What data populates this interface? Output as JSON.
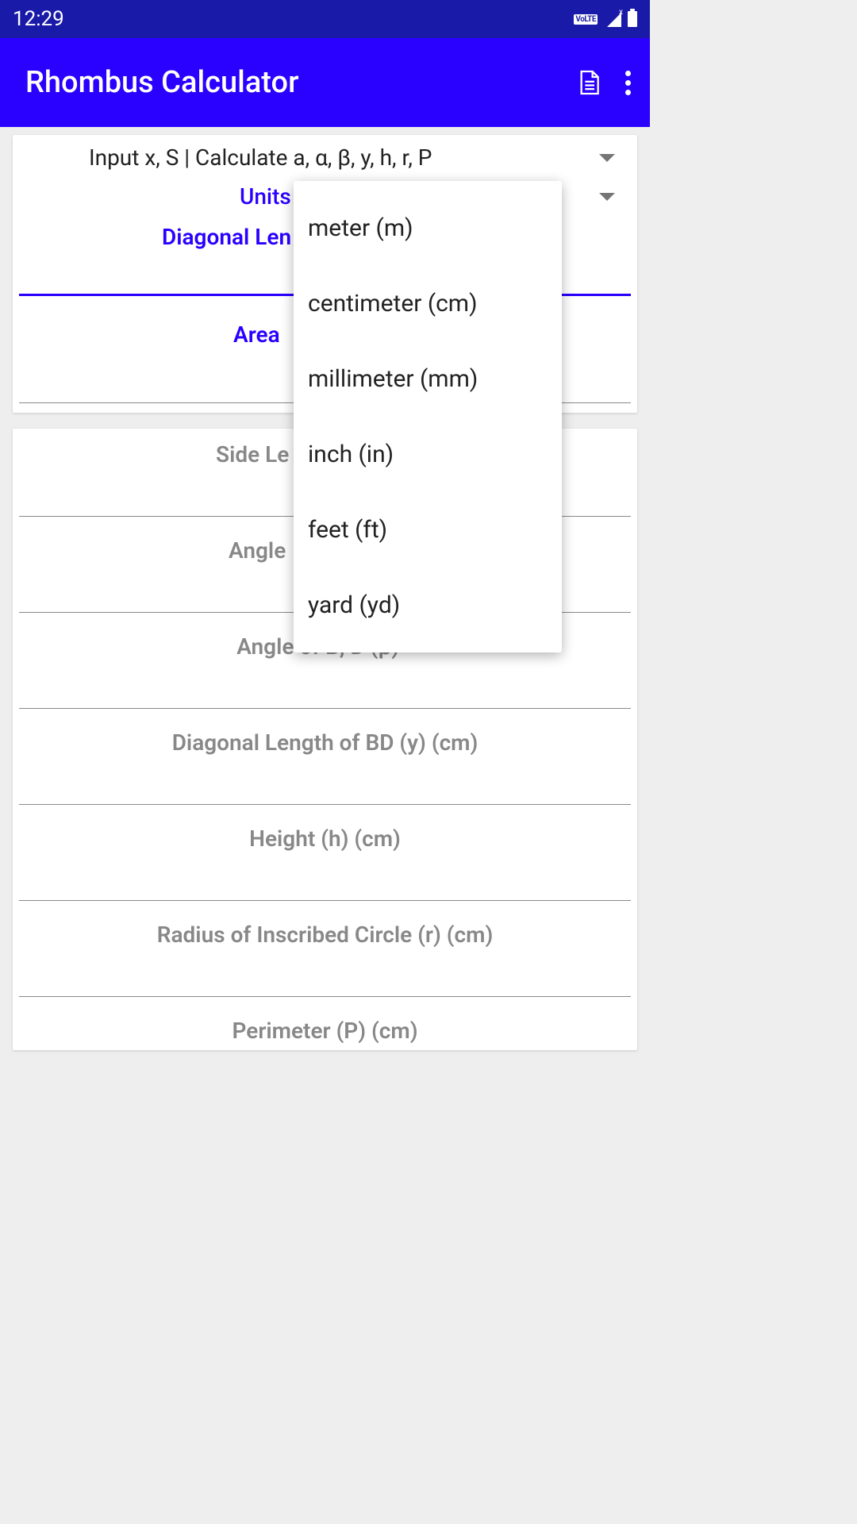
{
  "status": {
    "time": "12:29",
    "volte": "VoLTE",
    "signal_x": "x"
  },
  "appbar": {
    "title": "Rhombus Calculator"
  },
  "inputs": {
    "mode_spinner": "Input x, S | Calculate a, α, β, y, h, r, P",
    "units_label": "Units",
    "diagonal_label_partial": "Diagonal Len",
    "area_label_partial": "Area"
  },
  "outputs": {
    "side_label_partial": "Side Le",
    "angle_a_partial": "Angle",
    "angle_b": "Angle of B, D (β) °",
    "diagonal_bd": "Diagonal Length of BD (y) (cm)",
    "height": "Height (h) (cm)",
    "radius": "Radius of Inscribed Circle (r) (cm)",
    "perimeter": "Perimeter (P) (cm)"
  },
  "dropdown": {
    "options": {
      "0": "meter (m)",
      "1": "centimeter (cm)",
      "2": "millimeter (mm)",
      "3": "inch (in)",
      "4": "feet (ft)",
      "5": "yard (yd)"
    }
  }
}
